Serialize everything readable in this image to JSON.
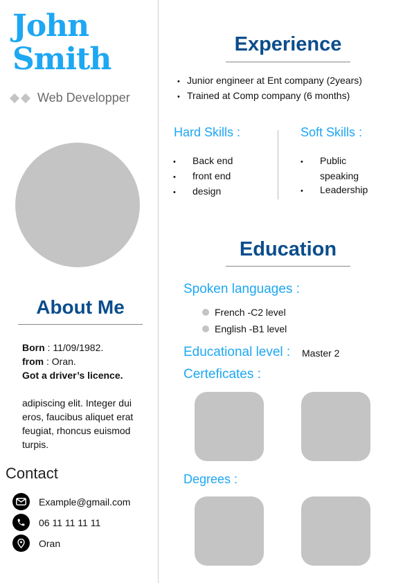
{
  "profile": {
    "first_name": "John",
    "last_name": "Smith",
    "role": "Web Developper"
  },
  "about": {
    "title": "About Me",
    "born_label": "Born",
    "born_value": " : 11/09/1982.",
    "from_label": "from",
    "from_value": " : Oran.",
    "licence": "Got a driver’s licence.",
    "paragraph": "adipiscing elit. Integer dui eros, faucibus aliquet erat feugiat, rhoncus euismod turpis."
  },
  "contact": {
    "title": "Contact",
    "items": [
      {
        "icon": "email-icon",
        "text": "Example@gmail.com"
      },
      {
        "icon": "phone-icon",
        "text": "06 11 11 11 11"
      },
      {
        "icon": "location-icon",
        "text": "Oran"
      }
    ]
  },
  "experience": {
    "title": "Experience",
    "items": [
      "Junior engineer at Ent company (2years)",
      "Trained at Comp company (6 months)"
    ]
  },
  "skills": {
    "hard_title": "Hard Skills :",
    "hard": [
      "Back end",
      "front end",
      "design"
    ],
    "soft_title": "Soft Skills :",
    "soft": [
      "Public speaking",
      "Leadership"
    ]
  },
  "education": {
    "title": "Education",
    "languages_title": "Spoken languages :",
    "languages": [
      "French  -C2 level",
      "English  -B1 level"
    ],
    "level_title": "Educational level :",
    "level_value": "Master 2",
    "certificates_title": "Certeficates :",
    "degrees_title": "Degrees :"
  },
  "colors": {
    "accent_light": "#1ea7f2",
    "accent_dark": "#0b4d8c",
    "placeholder_gray": "#c4c4c4"
  }
}
